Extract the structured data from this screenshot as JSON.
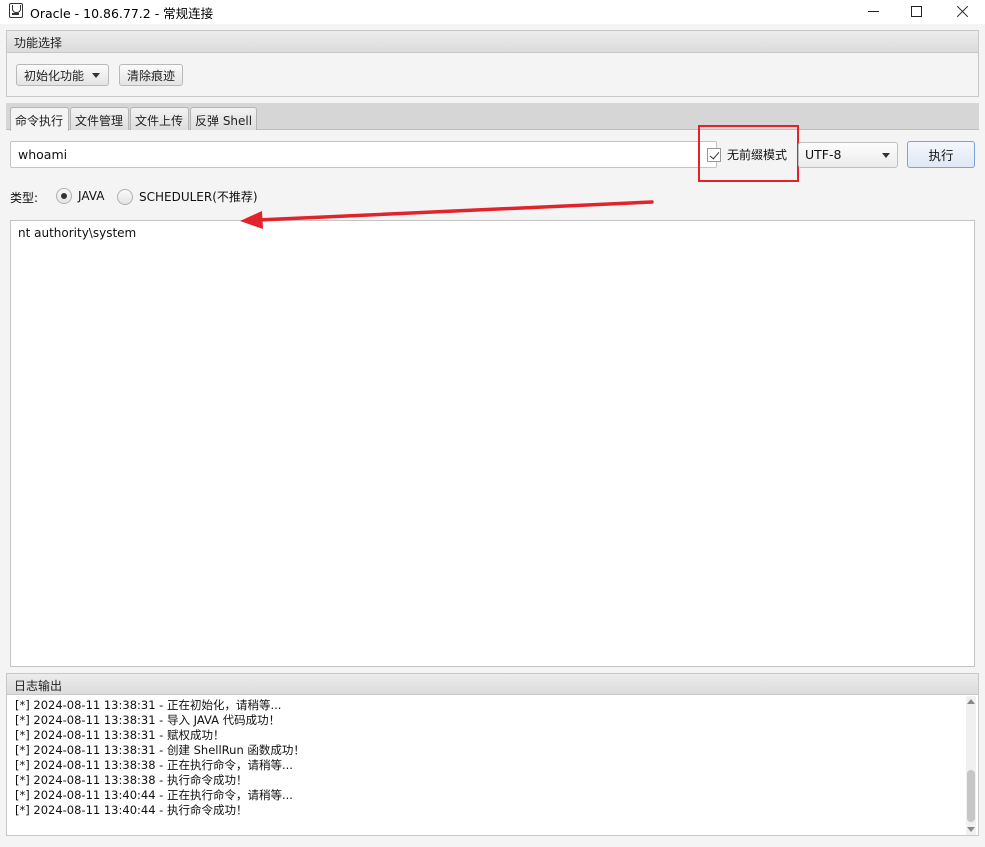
{
  "window": {
    "title": "Oracle - 10.86.77.2 - 常规连接"
  },
  "function_panel": {
    "header": "功能选择",
    "init_button": "初始化功能",
    "clear_button": "清除痕迹"
  },
  "tabs": [
    {
      "label": "命令执行",
      "active": true
    },
    {
      "label": "文件管理",
      "active": false
    },
    {
      "label": "文件上传",
      "active": false
    },
    {
      "label": "反弹 Shell",
      "active": false
    }
  ],
  "command": {
    "value": "whoami",
    "no_prefix_label": "无前缀模式",
    "no_prefix_checked": true,
    "encoding": "UTF-8",
    "execute_label": "执行"
  },
  "type_row": {
    "label": "类型:",
    "options": [
      {
        "label": "JAVA",
        "selected": true
      },
      {
        "label": "SCHEDULER(不推荐)",
        "selected": false
      }
    ]
  },
  "output": {
    "text": "nt authority\\system"
  },
  "log": {
    "header": "日志输出",
    "lines": [
      "[*] 2024-08-11 13:38:31 - 正在初始化，请稍等...",
      "[*] 2024-08-11 13:38:31 - 导入 JAVA 代码成功！",
      "[*] 2024-08-11 13:38:31 - 赋权成功！",
      "[*] 2024-08-11 13:38:31 - 创建 ShellRun 函数成功！",
      "[*] 2024-08-11 13:38:38 - 正在执行命令，请稍等...",
      "[*] 2024-08-11 13:38:38 - 执行命令成功！",
      "[*] 2024-08-11 13:40:44 - 正在执行命令，请稍等...",
      "[*] 2024-08-11 13:40:44 - 执行命令成功！"
    ]
  },
  "colors": {
    "annotation_red": "#e2232b",
    "accent_border": "#7aa3d8"
  }
}
